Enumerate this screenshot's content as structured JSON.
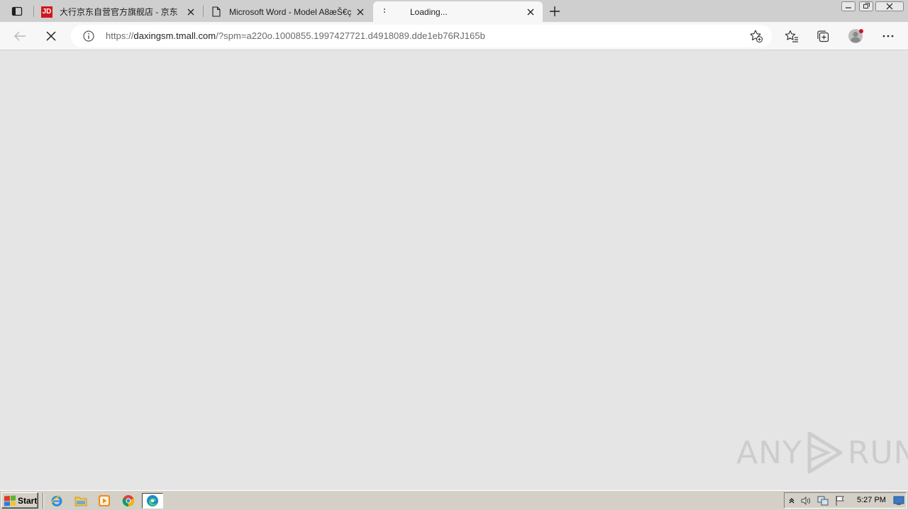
{
  "browser": {
    "tabs": [
      {
        "title": "大行京东自营官方旗舰店 - 京东",
        "favicon": "jd-logo",
        "favicon_text": "JD"
      },
      {
        "title": "Microsoft Word - Model A8æŠ€ç",
        "favicon": "document-icon"
      },
      {
        "title": "Loading...",
        "favicon": "loading-icon",
        "active": true
      }
    ],
    "address": {
      "url_scheme": "https://",
      "url_host": "daxingsm.tmall.com",
      "url_path": "/?spm=a220o.1000855.1997427721.d4918089.dde1eb76RJ165b"
    }
  },
  "content": {
    "background": "#e5e5e5",
    "watermark": {
      "left": "ANY",
      "right": "RUN"
    }
  },
  "taskbar": {
    "start_label": "Start",
    "clock": "5:27 PM",
    "pinned": [
      "ie-icon",
      "explorer-icon",
      "media-player-icon",
      "chrome-icon",
      "edge-icon"
    ]
  },
  "colors": {
    "tabstrip": "#cfcfcf",
    "toolbar": "#f7f7f7",
    "taskbar": "#d4d0c8",
    "jd_red": "#d0161f"
  }
}
